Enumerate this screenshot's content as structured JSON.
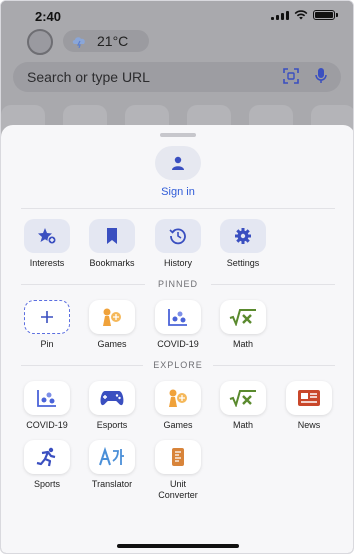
{
  "status_bar": {
    "time": "2:40"
  },
  "weather": {
    "temp": "21°C"
  },
  "url_bar": {
    "placeholder": "Search or type URL"
  },
  "account": {
    "sign_in_label": "Sign in"
  },
  "quick_actions": [
    {
      "label": "Interests",
      "icon": "star-plus-icon"
    },
    {
      "label": "Bookmarks",
      "icon": "bookmark-icon"
    },
    {
      "label": "History",
      "icon": "history-icon"
    },
    {
      "label": "Settings",
      "icon": "gear-icon"
    }
  ],
  "pinned": {
    "heading": "PINNED",
    "items": [
      {
        "label": "Pin",
        "icon": "plus-icon"
      },
      {
        "label": "Games",
        "icon": "games-icon"
      },
      {
        "label": "COVID-19",
        "icon": "covid-icon"
      },
      {
        "label": "Math",
        "icon": "math-icon"
      }
    ]
  },
  "explore": {
    "heading": "EXPLORE",
    "items": [
      {
        "label": "COVID-19",
        "icon": "covid-icon"
      },
      {
        "label": "Esports",
        "icon": "gamepad-icon"
      },
      {
        "label": "Games",
        "icon": "games-icon"
      },
      {
        "label": "Math",
        "icon": "math-icon"
      },
      {
        "label": "News",
        "icon": "news-icon"
      },
      {
        "label": "Sports",
        "icon": "runner-icon"
      },
      {
        "label": "Translator",
        "icon": "translator-icon"
      },
      {
        "label": "Unit\nConverter",
        "icon": "unit-converter-icon"
      }
    ]
  },
  "colors": {
    "accent_blue": "#2f5bd8",
    "icon_blue": "#4a63d8",
    "games_orange": "#f0a23a",
    "math_green": "#5a8a2e",
    "news_red": "#c9472a"
  }
}
